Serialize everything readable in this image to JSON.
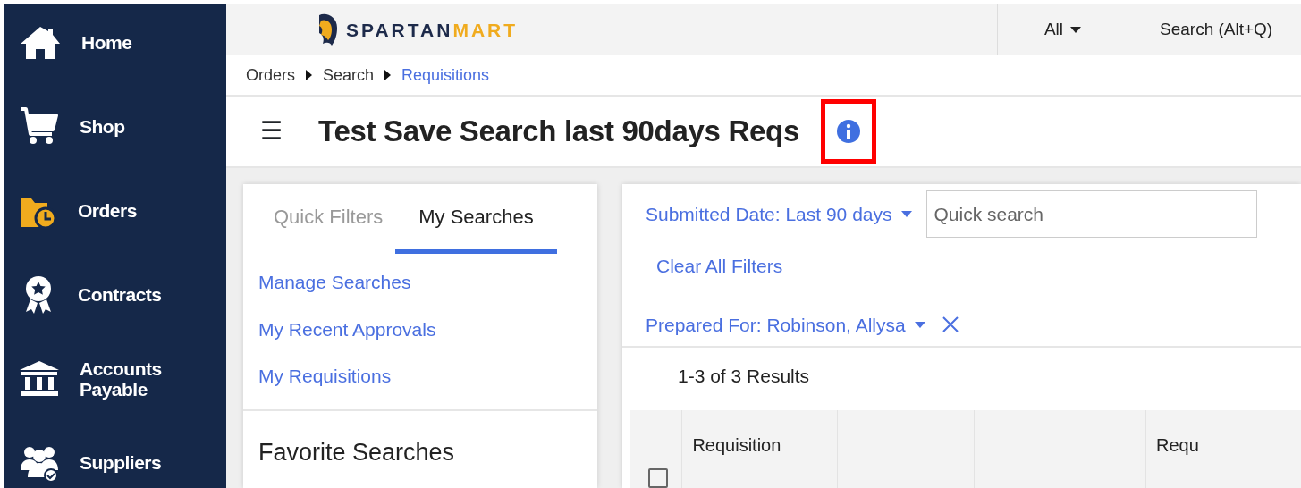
{
  "sidebar": {
    "items": [
      {
        "label": "Home"
      },
      {
        "label": "Shop"
      },
      {
        "label": "Orders"
      },
      {
        "label": "Contracts"
      },
      {
        "label": "Accounts Payable"
      },
      {
        "label": "Suppliers"
      }
    ]
  },
  "header": {
    "logo": {
      "first": "SPARTAN",
      "second": "MART"
    },
    "scope": "All",
    "search_placeholder": "Search (Alt+Q)"
  },
  "breadcrumb": [
    {
      "label": "Orders",
      "current": false
    },
    {
      "label": "Search",
      "current": false
    },
    {
      "label": "Requisitions",
      "current": true
    }
  ],
  "page": {
    "menu_glyph": "☰",
    "title": "Test Save Search last 90days Reqs",
    "info_highlighted": true
  },
  "left_panel": {
    "tabs": [
      {
        "label": "Quick Filters",
        "selected": false
      },
      {
        "label": "My Searches",
        "selected": true
      }
    ],
    "links": [
      "Manage Searches",
      "My Recent Approvals",
      "My Requisitions"
    ],
    "favorites_heading": "Favorite Searches"
  },
  "results": {
    "filters": [
      {
        "label": "Submitted Date: Last 90 days",
        "removable": false
      },
      {
        "label": "Clear All Filters",
        "kind": "action"
      },
      {
        "label": "Prepared For: Robinson, Allysa",
        "removable": true
      }
    ],
    "quick_search_placeholder": "Quick search",
    "count": "1-3 of 3 Results",
    "table": {
      "select_all_checked": false,
      "columns": [
        "Requisition",
        "",
        "",
        "Requ"
      ]
    }
  }
}
